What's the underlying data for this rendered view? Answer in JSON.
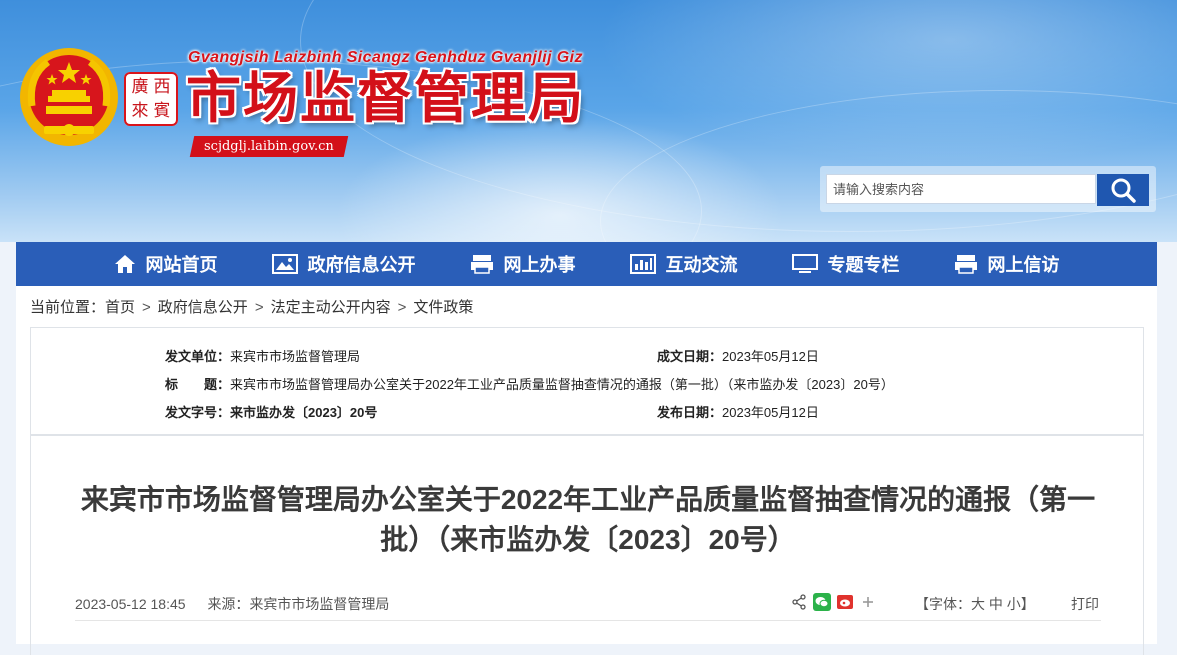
{
  "header": {
    "seal_text": [
      "廣",
      "西",
      "來",
      "賓"
    ],
    "pinyin_name": "Gvangjsih Laizbinh Sicangz Genhduz Gvanjlij Giz",
    "agency_name": "市场监督管理局",
    "domain": "scjdglj.laibin.gov.cn",
    "search": {
      "placeholder": "请输入搜索内容",
      "button_icon": "search-icon"
    }
  },
  "nav": {
    "items": [
      {
        "label": "网站首页",
        "icon": "home-icon"
      },
      {
        "label": "政府信息公开",
        "icon": "image-icon"
      },
      {
        "label": "网上办事",
        "icon": "service-icon"
      },
      {
        "label": "互动交流",
        "icon": "bar-chart-icon"
      },
      {
        "label": "专题专栏",
        "icon": "monitor-icon"
      },
      {
        "label": "网上信访",
        "icon": "printer-icon"
      }
    ]
  },
  "breadcrumb": {
    "prefix": "当前位置：",
    "items": [
      "首页",
      "政府信息公开",
      "法定主动公开内容",
      "文件政策"
    ],
    "separator": ">"
  },
  "meta": {
    "issuer_label": "发文单位：",
    "issuer": "来宾市市场监督管理局",
    "created_label": "成文日期：",
    "created": "2023年05月12日",
    "title_label": "标　　题：",
    "title": "来宾市市场监督管理局办公室关于2022年工业产品质量监督抽查情况的通报（第一批）（来市监办发〔2023〕20号）",
    "doc_no_label": "发文字号：",
    "doc_no": "来市监办发〔2023〕20号",
    "published_label": "发布日期：",
    "published": "2023年05月12日"
  },
  "article": {
    "title_line1": "来宾市市场监督管理局办公室关于2022年工业产品质量监督抽查情况的通报（第一",
    "title_line2": "批）（来市监办发〔2023〕20号）",
    "datetime": "2023-05-12 18:45",
    "source_label": "来源：",
    "source": "来宾市市场监督管理局",
    "font_size_label": "【字体：",
    "font_large": "大",
    "font_medium": "中",
    "font_small": "小",
    "font_size_end": "】",
    "print_label": "打印"
  },
  "colors": {
    "nav_bg": "#2a5eb8",
    "brand_red": "#d31019",
    "search_button": "#1f57b0"
  }
}
